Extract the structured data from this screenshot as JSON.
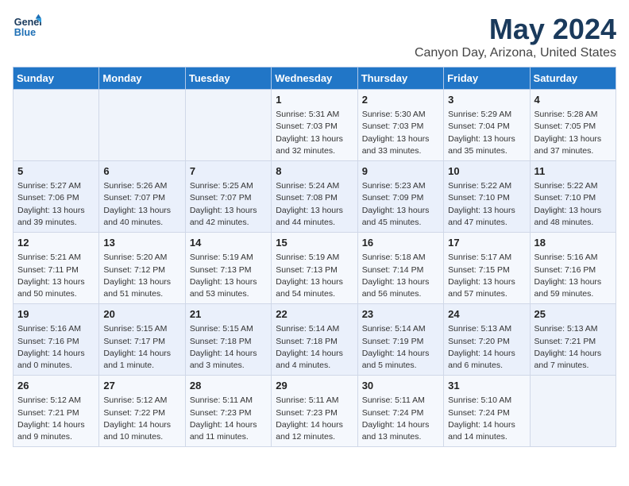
{
  "logo": {
    "line1": "General",
    "line2": "Blue"
  },
  "title": "May 2024",
  "subtitle": "Canyon Day, Arizona, United States",
  "days_header": [
    "Sunday",
    "Monday",
    "Tuesday",
    "Wednesday",
    "Thursday",
    "Friday",
    "Saturday"
  ],
  "weeks": [
    [
      {
        "num": "",
        "detail": ""
      },
      {
        "num": "",
        "detail": ""
      },
      {
        "num": "",
        "detail": ""
      },
      {
        "num": "1",
        "detail": "Sunrise: 5:31 AM\nSunset: 7:03 PM\nDaylight: 13 hours\nand 32 minutes."
      },
      {
        "num": "2",
        "detail": "Sunrise: 5:30 AM\nSunset: 7:03 PM\nDaylight: 13 hours\nand 33 minutes."
      },
      {
        "num": "3",
        "detail": "Sunrise: 5:29 AM\nSunset: 7:04 PM\nDaylight: 13 hours\nand 35 minutes."
      },
      {
        "num": "4",
        "detail": "Sunrise: 5:28 AM\nSunset: 7:05 PM\nDaylight: 13 hours\nand 37 minutes."
      }
    ],
    [
      {
        "num": "5",
        "detail": "Sunrise: 5:27 AM\nSunset: 7:06 PM\nDaylight: 13 hours\nand 39 minutes."
      },
      {
        "num": "6",
        "detail": "Sunrise: 5:26 AM\nSunset: 7:07 PM\nDaylight: 13 hours\nand 40 minutes."
      },
      {
        "num": "7",
        "detail": "Sunrise: 5:25 AM\nSunset: 7:07 PM\nDaylight: 13 hours\nand 42 minutes."
      },
      {
        "num": "8",
        "detail": "Sunrise: 5:24 AM\nSunset: 7:08 PM\nDaylight: 13 hours\nand 44 minutes."
      },
      {
        "num": "9",
        "detail": "Sunrise: 5:23 AM\nSunset: 7:09 PM\nDaylight: 13 hours\nand 45 minutes."
      },
      {
        "num": "10",
        "detail": "Sunrise: 5:22 AM\nSunset: 7:10 PM\nDaylight: 13 hours\nand 47 minutes."
      },
      {
        "num": "11",
        "detail": "Sunrise: 5:22 AM\nSunset: 7:10 PM\nDaylight: 13 hours\nand 48 minutes."
      }
    ],
    [
      {
        "num": "12",
        "detail": "Sunrise: 5:21 AM\nSunset: 7:11 PM\nDaylight: 13 hours\nand 50 minutes."
      },
      {
        "num": "13",
        "detail": "Sunrise: 5:20 AM\nSunset: 7:12 PM\nDaylight: 13 hours\nand 51 minutes."
      },
      {
        "num": "14",
        "detail": "Sunrise: 5:19 AM\nSunset: 7:13 PM\nDaylight: 13 hours\nand 53 minutes."
      },
      {
        "num": "15",
        "detail": "Sunrise: 5:19 AM\nSunset: 7:13 PM\nDaylight: 13 hours\nand 54 minutes."
      },
      {
        "num": "16",
        "detail": "Sunrise: 5:18 AM\nSunset: 7:14 PM\nDaylight: 13 hours\nand 56 minutes."
      },
      {
        "num": "17",
        "detail": "Sunrise: 5:17 AM\nSunset: 7:15 PM\nDaylight: 13 hours\nand 57 minutes."
      },
      {
        "num": "18",
        "detail": "Sunrise: 5:16 AM\nSunset: 7:16 PM\nDaylight: 13 hours\nand 59 minutes."
      }
    ],
    [
      {
        "num": "19",
        "detail": "Sunrise: 5:16 AM\nSunset: 7:16 PM\nDaylight: 14 hours\nand 0 minutes."
      },
      {
        "num": "20",
        "detail": "Sunrise: 5:15 AM\nSunset: 7:17 PM\nDaylight: 14 hours\nand 1 minute."
      },
      {
        "num": "21",
        "detail": "Sunrise: 5:15 AM\nSunset: 7:18 PM\nDaylight: 14 hours\nand 3 minutes."
      },
      {
        "num": "22",
        "detail": "Sunrise: 5:14 AM\nSunset: 7:18 PM\nDaylight: 14 hours\nand 4 minutes."
      },
      {
        "num": "23",
        "detail": "Sunrise: 5:14 AM\nSunset: 7:19 PM\nDaylight: 14 hours\nand 5 minutes."
      },
      {
        "num": "24",
        "detail": "Sunrise: 5:13 AM\nSunset: 7:20 PM\nDaylight: 14 hours\nand 6 minutes."
      },
      {
        "num": "25",
        "detail": "Sunrise: 5:13 AM\nSunset: 7:21 PM\nDaylight: 14 hours\nand 7 minutes."
      }
    ],
    [
      {
        "num": "26",
        "detail": "Sunrise: 5:12 AM\nSunset: 7:21 PM\nDaylight: 14 hours\nand 9 minutes."
      },
      {
        "num": "27",
        "detail": "Sunrise: 5:12 AM\nSunset: 7:22 PM\nDaylight: 14 hours\nand 10 minutes."
      },
      {
        "num": "28",
        "detail": "Sunrise: 5:11 AM\nSunset: 7:23 PM\nDaylight: 14 hours\nand 11 minutes."
      },
      {
        "num": "29",
        "detail": "Sunrise: 5:11 AM\nSunset: 7:23 PM\nDaylight: 14 hours\nand 12 minutes."
      },
      {
        "num": "30",
        "detail": "Sunrise: 5:11 AM\nSunset: 7:24 PM\nDaylight: 14 hours\nand 13 minutes."
      },
      {
        "num": "31",
        "detail": "Sunrise: 5:10 AM\nSunset: 7:24 PM\nDaylight: 14 hours\nand 14 minutes."
      },
      {
        "num": "",
        "detail": ""
      }
    ]
  ]
}
